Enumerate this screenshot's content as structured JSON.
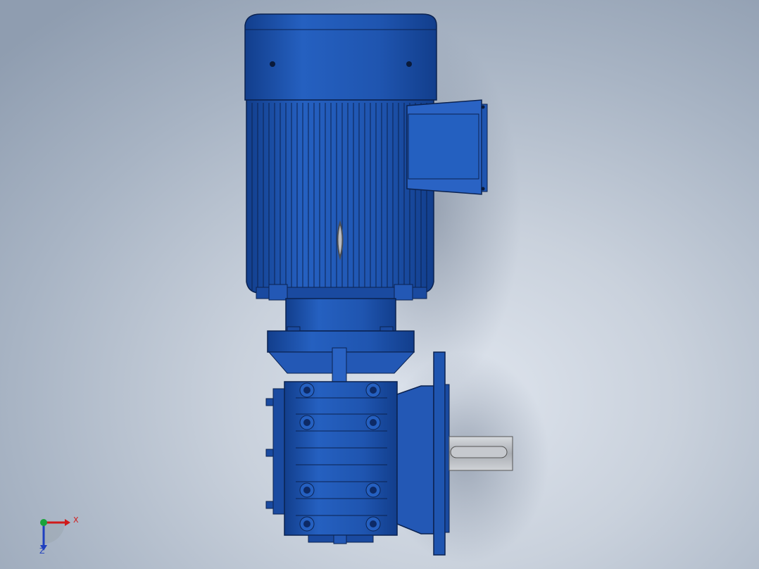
{
  "viewport": {
    "background": "#c9d1dc",
    "model_color": "#1f55b0",
    "shaft_color": "#b8bcc2"
  },
  "triad": {
    "x_label": "X",
    "z_label": "Z",
    "x_color": "#d01a1a",
    "y_color": "#1aa33a",
    "z_color": "#1f3fbf"
  }
}
